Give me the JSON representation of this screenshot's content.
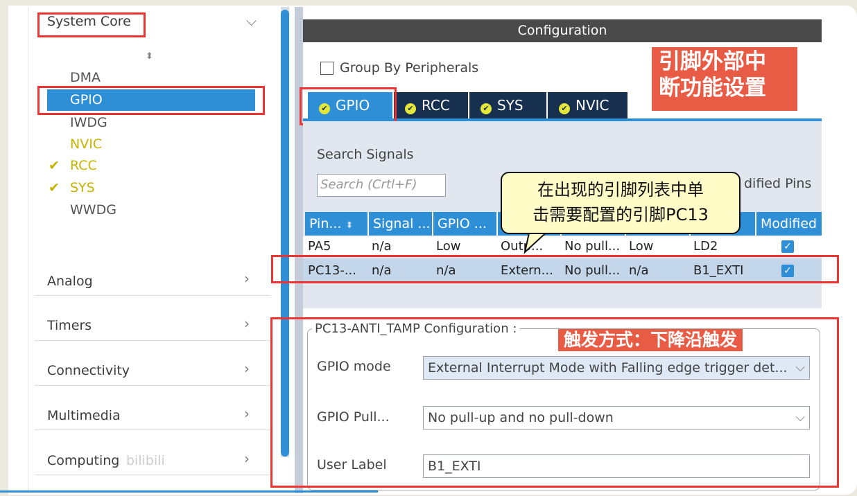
{
  "sidebar": {
    "category_system_core": "System Core",
    "items": [
      "DMA",
      "GPIO",
      "IWDG",
      "NVIC",
      "RCC",
      "SYS",
      "WWDG"
    ],
    "sort_glyph": "⬍",
    "check_glyph": "✔",
    "categories": [
      "Analog",
      "Timers",
      "Connectivity",
      "Multimedia",
      "Computing"
    ],
    "chevron_down": "⌵",
    "chevron_right": "›",
    "watermark": "bilibili"
  },
  "config": {
    "header": "Configuration",
    "group_by_label": "Group By Peripherals",
    "tabs": [
      "GPIO",
      "RCC",
      "SYS",
      "NVIC"
    ],
    "tab_check": "✔",
    "search_label": "Search Signals",
    "search_placeholder": "Search (Crtl+F)",
    "modified_pins_partial": "dified Pins",
    "table": {
      "headers": [
        "Pin...",
        "Signal ...",
        "GPIO ...",
        "",
        "",
        "",
        "",
        "Modified"
      ],
      "sort_glyph": "⬍",
      "rows": [
        [
          "PA5",
          "n/a",
          "Low",
          "Outp...",
          "No pull...",
          "Low",
          "LD2"
        ],
        [
          "PC13-...",
          "n/a",
          "n/a",
          "Extern...",
          "No pull...",
          "n/a",
          "B1_EXTI"
        ]
      ],
      "check_glyph": "✓"
    },
    "pin_config": {
      "legend": "PC13-ANTI_TAMP Configuration :",
      "fields": [
        {
          "label": "GPIO mode",
          "value": "External Interrupt Mode with Falling edge trigger det..."
        },
        {
          "label": "GPIO Pull...",
          "value": "No pull-up and no pull-down"
        },
        {
          "label": "User Label",
          "value": "B1_EXTI"
        }
      ],
      "select_chevron": "⌵"
    }
  },
  "annotations": {
    "title_line1": "引脚外部中",
    "title_line2": "断功能设置",
    "callout_line1": "在出现的引脚列表中单",
    "callout_line2": "击需要配置的引脚PC13",
    "trigger": "触发方式：下降沿触发"
  }
}
